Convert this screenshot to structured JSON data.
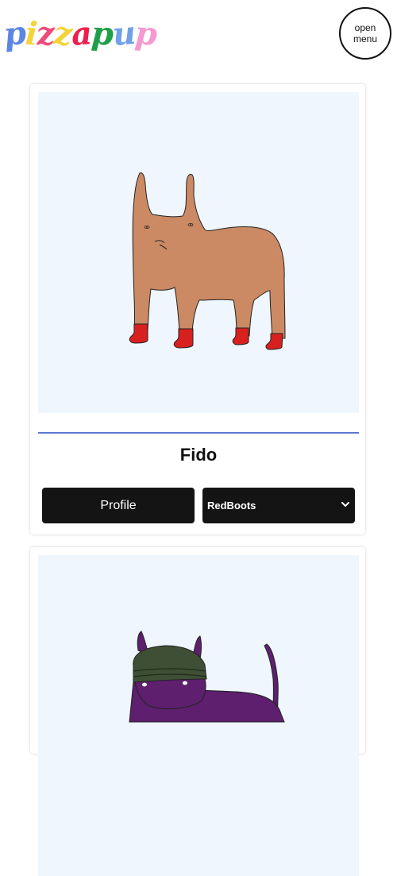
{
  "header": {
    "logo_letters": [
      {
        "char": "p",
        "color": "#5b86e5"
      },
      {
        "char": "i",
        "color": "#f5d33a"
      },
      {
        "char": "z",
        "color": "#f04a7a"
      },
      {
        "char": "z",
        "color": "#f2d43a"
      },
      {
        "char": "a",
        "color": "#ef1e4c"
      },
      {
        "char": "p",
        "color": "#1f9e4a"
      },
      {
        "char": "u",
        "color": "#6fa0e8"
      },
      {
        "char": "p",
        "color": "#f49ad0"
      }
    ],
    "menu_button_label": "open menu"
  },
  "colors": {
    "image_bg": "#eff6fe",
    "divider": "#5b78d6",
    "button_bg": "#141414",
    "dog_body": "#cb8a64",
    "boots": "#d8211f",
    "purple_dog": "#5d1f6e",
    "beanie": "#3f4f36"
  },
  "pets": [
    {
      "name": "Fido",
      "profile_label": "Profile",
      "outfit_selected": "RedBoots",
      "image_icon": "tan-dog-with-red-boots-icon"
    },
    {
      "name": "",
      "image_icon": "purple-dog-with-beanie-icon"
    }
  ]
}
